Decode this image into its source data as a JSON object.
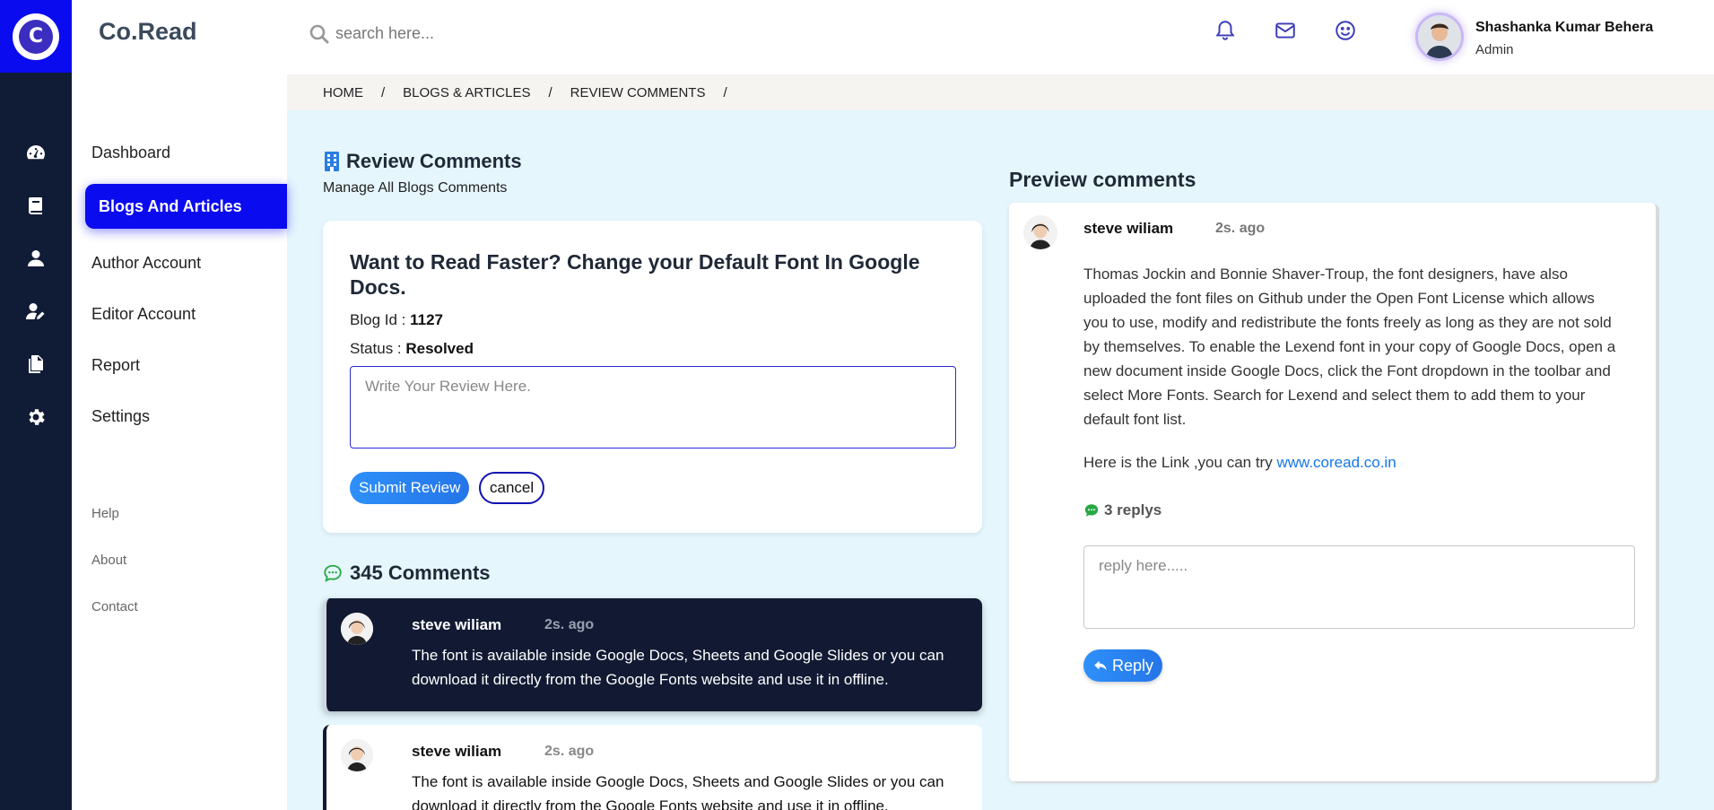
{
  "app": {
    "brand": "Co.Read",
    "logo_letter": "C"
  },
  "rail": {
    "icons": [
      "dashboard-gauge-icon",
      "book-icon",
      "user-icon",
      "user-edit-icon",
      "copy-files-icon",
      "gear-icon"
    ]
  },
  "sidebar": {
    "items": [
      {
        "label": "Dashboard"
      },
      {
        "label": "Blogs And Articles",
        "active": true
      },
      {
        "label": "Author Account"
      },
      {
        "label": "Editor Account"
      },
      {
        "label": "Report"
      },
      {
        "label": "Settings"
      }
    ],
    "footer": [
      {
        "label": "Help"
      },
      {
        "label": "About"
      },
      {
        "label": "Contact"
      }
    ]
  },
  "topbar": {
    "search": {
      "placeholder": "search here..."
    },
    "icons": [
      "bell-icon",
      "mail-icon",
      "smiley-icon"
    ],
    "user": {
      "name": "Shashanka Kumar Behera",
      "role": "Admin"
    }
  },
  "breadcrumb": {
    "items": [
      "HOME",
      "BLOGS & ARTICLES",
      "REVIEW COMMENTS"
    ],
    "separator": "/"
  },
  "review": {
    "title": "Review Comments",
    "subtitle": "Manage All Blogs Comments",
    "card": {
      "heading": "Want to Read Faster? Change your Default Font In Google Docs.",
      "blog_id_label": "Blog Id : ",
      "blog_id": "1127",
      "status_label": "Status : ",
      "status": "Resolved",
      "placeholder": "Write Your Review Here.",
      "submit_label": "Submit Review",
      "cancel_label": "cancel"
    }
  },
  "comments": {
    "count_label": "345 Comments",
    "items": [
      {
        "name": "steve wiliam",
        "time": "2s. ago",
        "text": "The font is available inside Google Docs, Sheets and Google Slides or you can download it directly from the Google Fonts website and use it in offline.",
        "selected": true
      },
      {
        "name": "steve wiliam",
        "time": "2s. ago",
        "text": "The font is available inside Google Docs, Sheets and Google Slides or you can download it directly from the Google Fonts website and use it in offline.",
        "selected": false
      }
    ]
  },
  "preview": {
    "title": "Preview comments",
    "name": "steve wiliam",
    "time": "2s. ago",
    "body": "Thomas Jockin and Bonnie Shaver-Troup, the font designers, have also uploaded the font files on Github under the Open Font License which allows you to use, modify and redistribute the fonts freely as long as they are not sold by themselves. To enable the Lexend font in your copy of Google Docs, open a new document inside Google Docs, click the Font dropdown in the toolbar and select More Fonts. Search for Lexend and select them to add them to your default font list.",
    "link_prefix": "Here is the Link ,you can try ",
    "link_text": "www.coread.co.in",
    "replies_label": "3 replys",
    "reply_placeholder": "reply here.....",
    "reply_button": "Reply"
  },
  "colors": {
    "rail": "#101c36",
    "accent": "#0b0bf0",
    "background": "#e5f6fd",
    "link": "#1677e6",
    "reply_icon": "#27a844"
  }
}
